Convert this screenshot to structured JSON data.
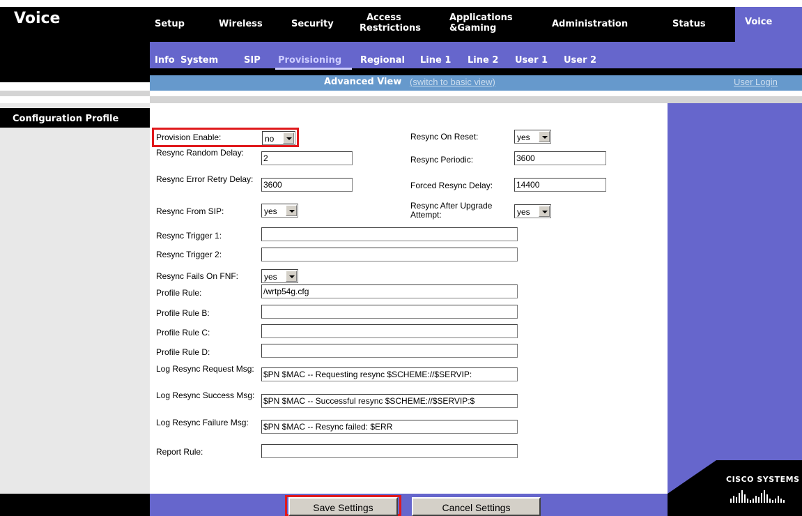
{
  "app": {
    "brand": "Voice"
  },
  "main_tabs": [
    {
      "line1": "Setup",
      "line2": ""
    },
    {
      "line1": "Wireless",
      "line2": ""
    },
    {
      "line1": "Security",
      "line2": ""
    },
    {
      "line1": "Access",
      "line2": "Restrictions"
    },
    {
      "line1": "Applications",
      "line2": "&Gaming"
    },
    {
      "line1": "Administration",
      "line2": ""
    },
    {
      "line1": "Status",
      "line2": ""
    },
    {
      "line1": "Voice",
      "line2": ""
    }
  ],
  "sub_tabs": [
    "Info",
    "System",
    "SIP",
    "Provisioning",
    "Regional",
    "Line 1",
    "Line 2",
    "User 1",
    "User 2"
  ],
  "view_bar": {
    "advanced_label": "Advanced View",
    "switch_link": "(switch to basic view)",
    "user_login": "User Login"
  },
  "section": {
    "title": "Configuration Profile"
  },
  "form": {
    "provision_enable": {
      "label": "Provision Enable:",
      "value": "no"
    },
    "resync_on_reset": {
      "label": "Resync On Reset:",
      "value": "yes"
    },
    "resync_random_delay": {
      "label": "Resync Random Delay:",
      "value": "2"
    },
    "resync_periodic": {
      "label": "Resync Periodic:",
      "value": "3600"
    },
    "resync_error_retry_delay": {
      "label": "Resync Error Retry Delay:",
      "value": "3600"
    },
    "forced_resync_delay": {
      "label": "Forced Resync Delay:",
      "value": "14400"
    },
    "resync_from_sip": {
      "label": "Resync From SIP:",
      "value": "yes"
    },
    "resync_after_upgrade": {
      "label": "Resync After Upgrade Attempt:",
      "value": "yes"
    },
    "resync_trigger_1": {
      "label": "Resync Trigger 1:",
      "value": ""
    },
    "resync_trigger_2": {
      "label": "Resync Trigger 2:",
      "value": ""
    },
    "resync_fails_on_fnf": {
      "label": "Resync Fails On FNF:",
      "value": "yes"
    },
    "profile_rule": {
      "label": "Profile Rule:",
      "value": "/wrtp54g.cfg"
    },
    "profile_rule_b": {
      "label": "Profile Rule B:",
      "value": ""
    },
    "profile_rule_c": {
      "label": "Profile Rule C:",
      "value": ""
    },
    "profile_rule_d": {
      "label": "Profile Rule D:",
      "value": ""
    },
    "log_resync_request": {
      "label": "Log Resync Request Msg:",
      "value": "$PN $MAC -- Requesting resync $SCHEME://$SERVIP:"
    },
    "log_resync_success": {
      "label": "Log Resync Success Msg:",
      "value": "$PN $MAC -- Successful resync $SCHEME://$SERVIP:$"
    },
    "log_resync_failure": {
      "label": "Log Resync Failure Msg:",
      "value": "$PN $MAC -- Resync failed: $ERR"
    },
    "report_rule": {
      "label": "Report Rule:",
      "value": ""
    }
  },
  "buttons": {
    "save": "Save Settings",
    "cancel": "Cancel Settings"
  },
  "logo": {
    "text": "CISCO SYSTEMS"
  },
  "colors": {
    "accent": "#6666cc",
    "highlight": "#e0191c",
    "viewbar": "#6699cc"
  }
}
